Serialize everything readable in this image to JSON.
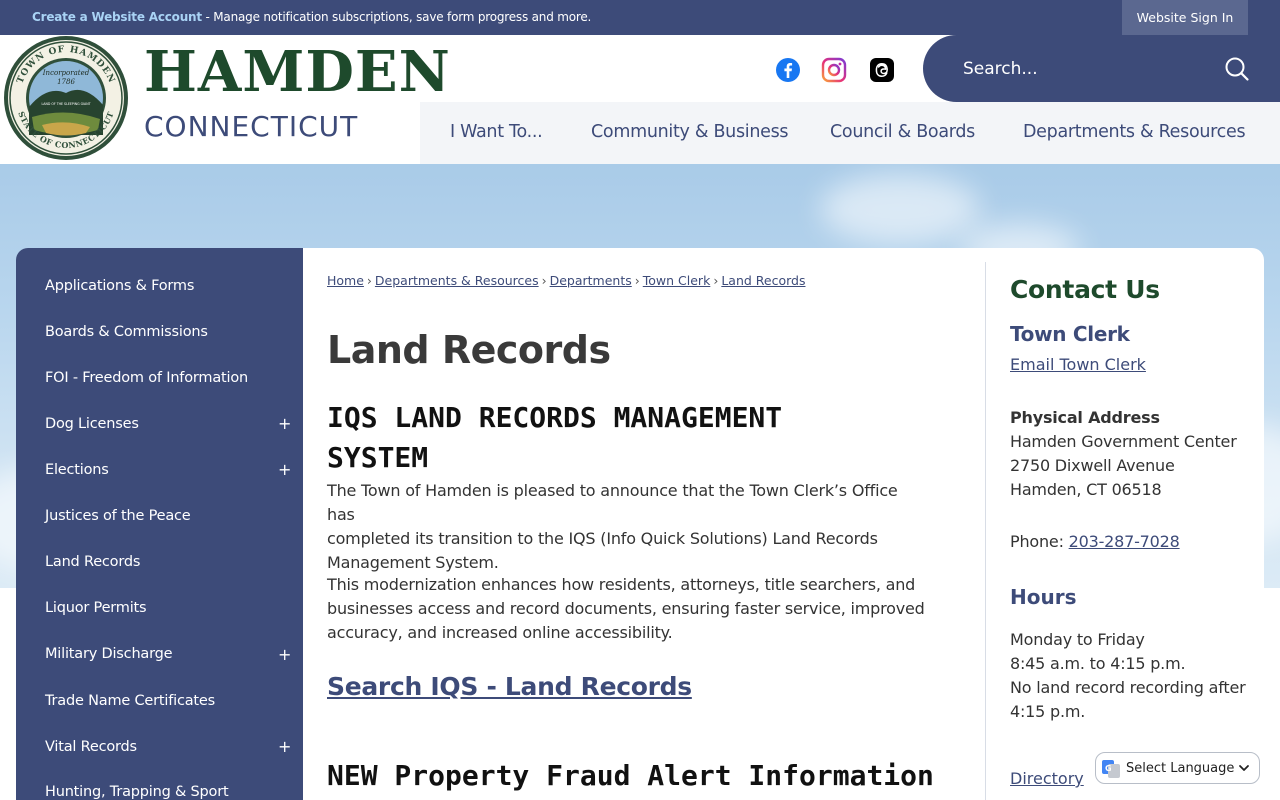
{
  "topbar": {
    "create_account_link": "Create a Website Account",
    "create_account_desc": " - Manage notification subscriptions, save form progress and more.",
    "sign_in": "Website Sign In"
  },
  "header": {
    "seal_text_top": "TOWN OF HAMDEN",
    "seal_text_bottom": "STATE OF CONNECTICUT",
    "seal_incorporated": "Incorporated",
    "seal_year": "1786",
    "seal_motto": "LAND OF THE SLEEPING GIANT",
    "title": "HAMDEN",
    "subtitle": "CONNECTICUT",
    "search_placeholder": "Search...",
    "social": [
      "facebook-icon",
      "instagram-icon",
      "threads-icon"
    ]
  },
  "nav": {
    "items": [
      "I Want To...",
      "Community & Business",
      "Council & Boards",
      "Departments & Resources"
    ]
  },
  "sidebar": {
    "items": [
      {
        "label": "Applications & Forms",
        "expandable": false
      },
      {
        "label": "Boards & Commissions",
        "expandable": false
      },
      {
        "label": "FOI - Freedom of Information",
        "expandable": false
      },
      {
        "label": "Dog Licenses",
        "expandable": true
      },
      {
        "label": "Elections",
        "expandable": true
      },
      {
        "label": "Justices of the Peace",
        "expandable": false
      },
      {
        "label": "Land Records",
        "expandable": false
      },
      {
        "label": "Liquor Permits",
        "expandable": false
      },
      {
        "label": "Military Discharge",
        "expandable": true
      },
      {
        "label": "Trade Name Certificates",
        "expandable": false
      },
      {
        "label": "Vital Records",
        "expandable": true
      },
      {
        "label": "Hunting, Trapping & Sport",
        "expandable": false
      }
    ],
    "expand_symbol": "+"
  },
  "breadcrumb": {
    "items": [
      "Home",
      "Departments & Resources",
      "Departments",
      "Town Clerk",
      "Land Records"
    ],
    "separator": "›"
  },
  "main": {
    "page_title": "Land Records",
    "heading1_line1": "IQS LAND RECORDS MANAGEMENT",
    "heading1_line2": "SYSTEM",
    "para1_line1": "The Town of Hamden is pleased to announce that the Town Clerk’s Office has",
    "para1_line2": "completed its transition to the IQS (Info Quick Solutions) Land Records",
    "para1_line3": "Management System.",
    "para2_line1": "This modernization enhances how residents, attorneys, title searchers, and",
    "para2_line2": "businesses access and record documents, ensuring faster service, improved",
    "para2_line3": "accuracy, and increased online accessibility.",
    "search_link": "Search IQS - Land Records",
    "heading2": "NEW Property Fraud Alert Information"
  },
  "contact": {
    "heading": "Contact Us",
    "dept": "Town Clerk",
    "email_link": "Email Town Clerk",
    "address_label": "Physical Address",
    "address_line1": "Hamden Government Center",
    "address_line2": "2750 Dixwell Avenue",
    "address_line3": "Hamden, CT 06518",
    "phone_label": "Phone: ",
    "phone": "203-287-7028",
    "hours_heading": "Hours",
    "hours_line1": "Monday to Friday",
    "hours_line2": "8:45 a.m. to 4:15 p.m.",
    "hours_line3": "No land record recording after",
    "hours_line4": "4:15 p.m.",
    "directory_link": "Directory"
  },
  "translate": {
    "label": "Select Language"
  },
  "colors": {
    "navy": "#3d4b79",
    "green": "#1e4a2c",
    "link_light": "#a9d3f5"
  }
}
